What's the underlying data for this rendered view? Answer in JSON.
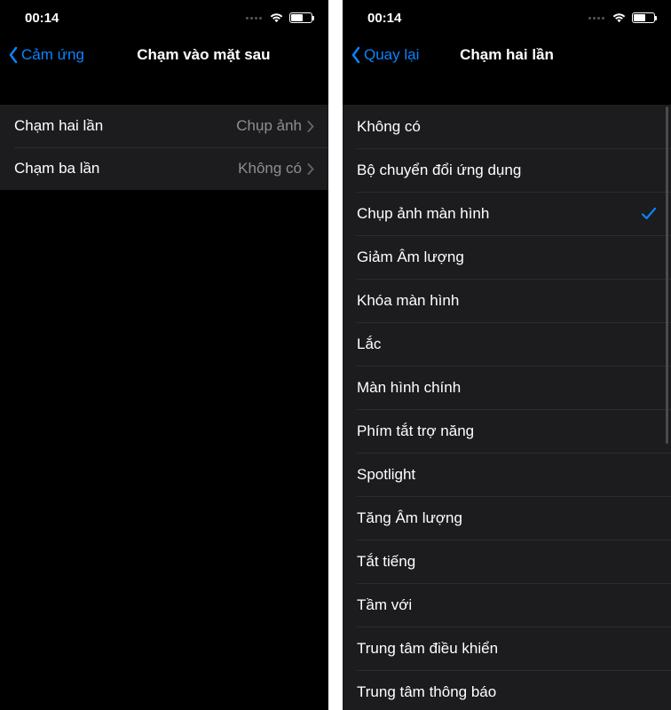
{
  "status": {
    "time": "00:14"
  },
  "left": {
    "back_label": "Cảm ứng",
    "title": "Chạm vào mặt sau",
    "rows": [
      {
        "label": "Chạm hai lần",
        "value": "Chụp ảnh"
      },
      {
        "label": "Chạm ba lần",
        "value": "Không có"
      }
    ]
  },
  "right": {
    "back_label": "Quay lại",
    "title": "Chạm hai lần",
    "options": [
      {
        "label": "Không có",
        "selected": false
      },
      {
        "label": "Bộ chuyển đổi ứng dụng",
        "selected": false
      },
      {
        "label": "Chụp ảnh màn hình",
        "selected": true
      },
      {
        "label": "Giảm Âm lượng",
        "selected": false
      },
      {
        "label": "Khóa màn hình",
        "selected": false
      },
      {
        "label": "Lắc",
        "selected": false
      },
      {
        "label": "Màn hình chính",
        "selected": false
      },
      {
        "label": "Phím tắt trợ năng",
        "selected": false
      },
      {
        "label": "Spotlight",
        "selected": false
      },
      {
        "label": "Tăng Âm lượng",
        "selected": false
      },
      {
        "label": "Tắt tiếng",
        "selected": false
      },
      {
        "label": "Tầm với",
        "selected": false
      },
      {
        "label": "Trung tâm điều khiển",
        "selected": false
      },
      {
        "label": "Trung tâm thông báo",
        "selected": false
      }
    ]
  }
}
